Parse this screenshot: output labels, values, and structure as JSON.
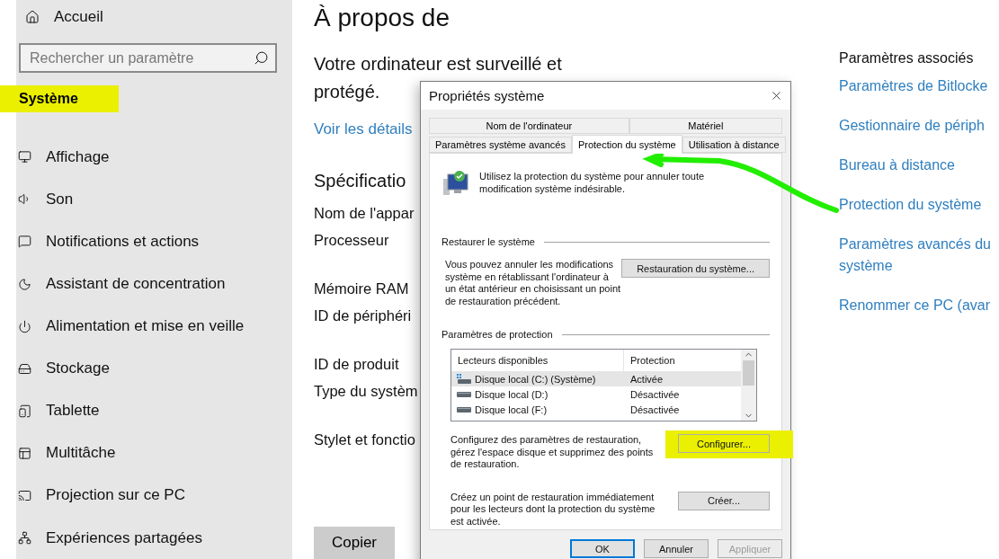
{
  "sidebar": {
    "home": "Accueil",
    "search": {
      "placeholder": "Rechercher un paramètre"
    },
    "heading": {
      "label": "Système",
      "highlighted": true
    },
    "items": [
      {
        "label": "Affichage"
      },
      {
        "label": "Son"
      },
      {
        "label": "Notifications et actions"
      },
      {
        "label": "Assistant de concentration"
      },
      {
        "label": "Alimentation et mise en veille"
      },
      {
        "label": "Stockage"
      },
      {
        "label": "Tablette"
      },
      {
        "label": "Multitâche"
      },
      {
        "label": "Projection sur ce PC"
      },
      {
        "label": "Expériences partagées"
      }
    ]
  },
  "page": {
    "title": "À propos de",
    "status_lines": [
      "Votre ordinateur est surveillé et",
      "protégé."
    ],
    "details_link": "Voir les détails",
    "specs_title": "Spécificatio",
    "spec_groups": [
      [
        "Nom de l'appar",
        "Processeur"
      ],
      [
        "Mémoire RAM",
        "ID de périphéri"
      ],
      [
        "ID de produit",
        "Type du systèm"
      ],
      [
        "Stylet et fonctio"
      ]
    ],
    "copy_button": "Copier"
  },
  "related": {
    "title": "Paramètres associés",
    "links": [
      "Paramètres de Bitlocke",
      "Gestionnaire de périph",
      "Bureau à distance",
      "Protection du système",
      "Paramètres avancés du système",
      "Renommer ce PC (avar"
    ]
  },
  "dialog": {
    "title": "Propriétés système",
    "tabs_back": [
      {
        "label": "Nom de l'ordinateur",
        "selected": false
      },
      {
        "label": "Matériel",
        "selected": false
      }
    ],
    "tabs_front": [
      {
        "label": "Paramètres système avancés",
        "selected": false
      },
      {
        "label": "Protection du système",
        "selected": true
      },
      {
        "label": "Utilisation à distance",
        "selected": false
      }
    ],
    "intro": "Utilisez la protection du système pour annuler toute modification système indésirable.",
    "restore": {
      "title": "Restaurer le système",
      "text": "Vous pouvez annuler les modifications système en rétablissant l'ordinateur à un état antérieur en choisissant un point de restauration précédent.",
      "button": "Restauration du système..."
    },
    "protection": {
      "title": "Paramètres de protection",
      "columns": [
        "Lecteurs disponibles",
        "Protection"
      ],
      "drives": [
        {
          "name": "Disque local (C:) (Système)",
          "status": "Activée",
          "kind": "system",
          "selected": true
        },
        {
          "name": "Disque local (D:)",
          "status": "Désactivée",
          "kind": "local",
          "selected": false
        },
        {
          "name": "Disque local (F:)",
          "status": "Désactivée",
          "kind": "local",
          "selected": false
        }
      ],
      "configure": {
        "text": "Configurez des paramètres de restauration, gérez l'espace disque et supprimez des points de restauration.",
        "button": "Configurer...",
        "highlighted": true
      },
      "create": {
        "text": "Créez un point de restauration immédiatement pour les lecteurs dont la protection du système est activée.",
        "button": "Créer...",
        "highlighted": false
      }
    },
    "buttons": [
      {
        "label": "OK",
        "kind": "default",
        "disabled": false
      },
      {
        "label": "Annuler",
        "kind": "normal",
        "disabled": false
      },
      {
        "label": "Appliquer",
        "kind": "normal",
        "disabled": true
      }
    ]
  }
}
